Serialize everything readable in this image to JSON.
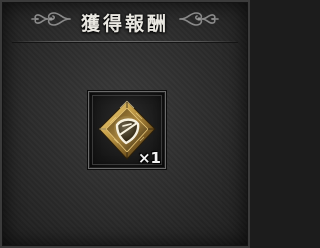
{
  "reward_panel": {
    "title": "獲得報酬",
    "item": {
      "icon": "golden-crystal-shield-emblem-icon",
      "quantity_label": "×1"
    }
  },
  "colors": {
    "panel_background": "#2e2e2e",
    "title_text": "#e9e7e1",
    "item_gold": "#c9a24a"
  }
}
